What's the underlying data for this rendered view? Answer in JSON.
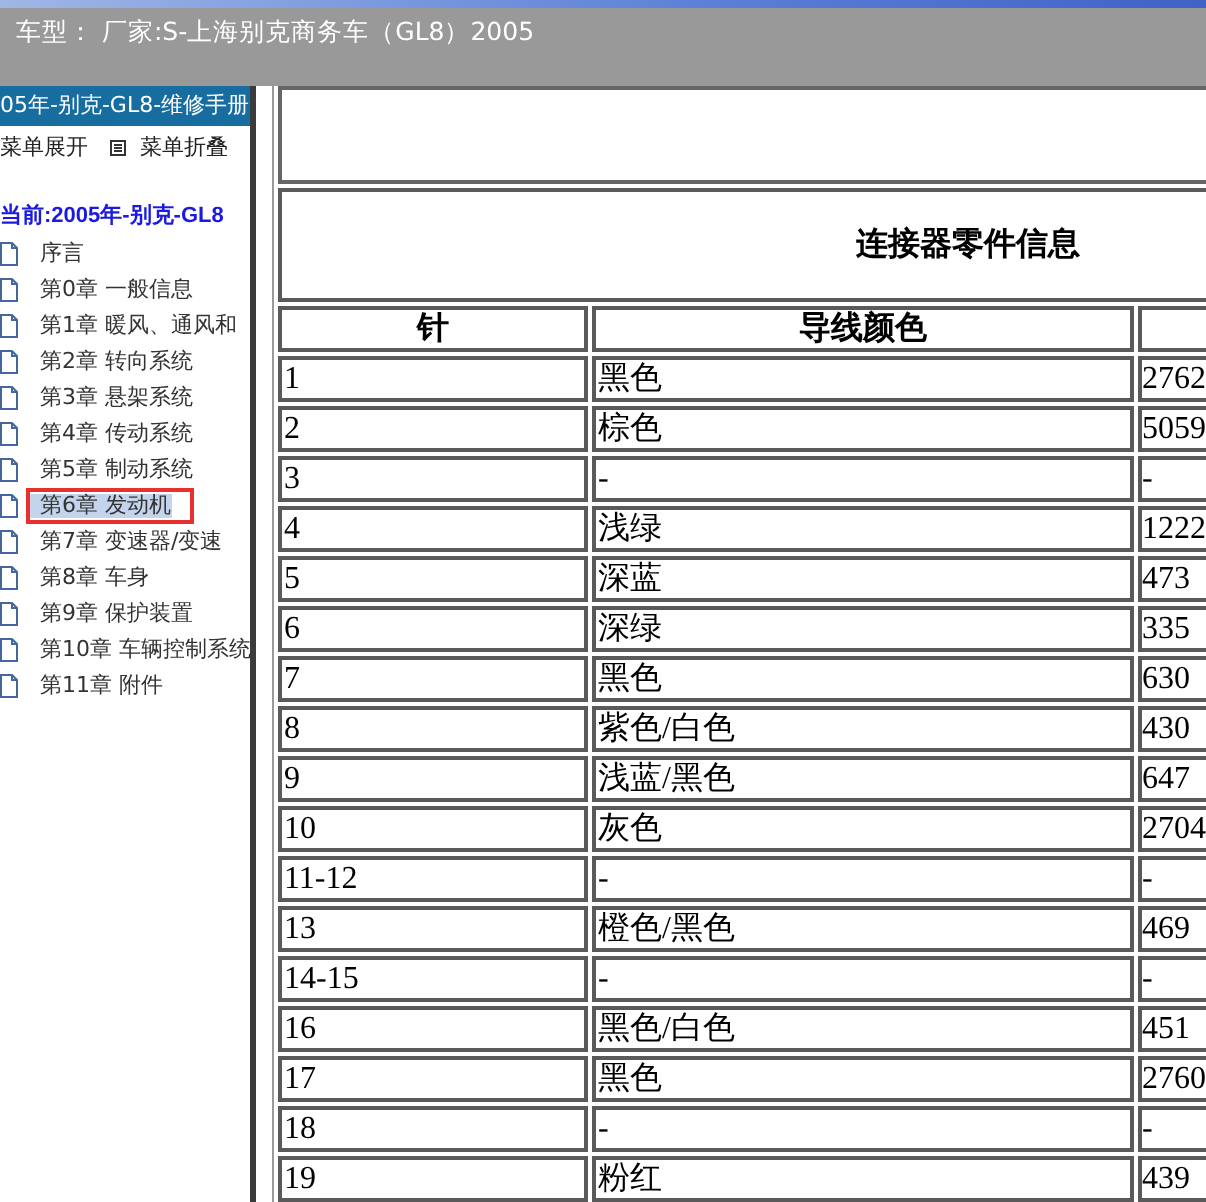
{
  "header_bar": {
    "text": "车型： 厂家:S-上海别克商务车（GL8）2005"
  },
  "sidebar": {
    "title": "05年-别克-GL8-维修手册",
    "toolbar": [
      {
        "label": "菜单展开"
      },
      {
        "label": "菜单折叠",
        "icon": true
      }
    ],
    "current": "当前:2005年-别克-GL8",
    "items": [
      {
        "label": "序言",
        "selected": false
      },
      {
        "label": "第0章 一般信息",
        "selected": false
      },
      {
        "label": "第1章 暖风、通风和",
        "selected": false
      },
      {
        "label": "第2章 转向系统",
        "selected": false
      },
      {
        "label": "第3章 悬架系统",
        "selected": false
      },
      {
        "label": "第4章 传动系统",
        "selected": false
      },
      {
        "label": "第5章 制动系统",
        "selected": false
      },
      {
        "label": "第6章 发动机",
        "selected": true
      },
      {
        "label": "第7章 变速器/变速",
        "selected": false
      },
      {
        "label": "第8章 车身",
        "selected": false
      },
      {
        "label": "第9章 保护装置",
        "selected": false
      },
      {
        "label": "第10章 车辆控制系统",
        "selected": false
      },
      {
        "label": "第11章 附件",
        "selected": false
      }
    ]
  },
  "connector_table": {
    "title": "连接器零件信息",
    "columns": [
      "针",
      "导线颜色"
    ],
    "rows": [
      {
        "pin": "1",
        "wire_color": "黑色",
        "column_3": "2762"
      },
      {
        "pin": "2",
        "wire_color": "棕色",
        "column_3": "5059"
      },
      {
        "pin": "3",
        "wire_color": "-",
        "column_3": "-"
      },
      {
        "pin": "4",
        "wire_color": "浅绿",
        "column_3": "1222"
      },
      {
        "pin": "5",
        "wire_color": "深蓝",
        "column_3": "473"
      },
      {
        "pin": "6",
        "wire_color": "深绿",
        "column_3": "335"
      },
      {
        "pin": "7",
        "wire_color": "黑色",
        "column_3": "630"
      },
      {
        "pin": "8",
        "wire_color": "紫色/白色",
        "column_3": "430"
      },
      {
        "pin": "9",
        "wire_color": "浅蓝/黑色",
        "column_3": "647"
      },
      {
        "pin": "10",
        "wire_color": "灰色",
        "column_3": "2704"
      },
      {
        "pin": "11-12",
        "wire_color": "-",
        "column_3": "-"
      },
      {
        "pin": "13",
        "wire_color": "橙色/黑色",
        "column_3": "469"
      },
      {
        "pin": "14-15",
        "wire_color": "-",
        "column_3": "-"
      },
      {
        "pin": "16",
        "wire_color": "黑色/白色",
        "column_3": "451"
      },
      {
        "pin": "17",
        "wire_color": "黑色",
        "column_3": "2760"
      },
      {
        "pin": "18",
        "wire_color": "-",
        "column_3": "-"
      },
      {
        "pin": "19",
        "wire_color": "粉红",
        "column_3": "439"
      }
    ]
  }
}
